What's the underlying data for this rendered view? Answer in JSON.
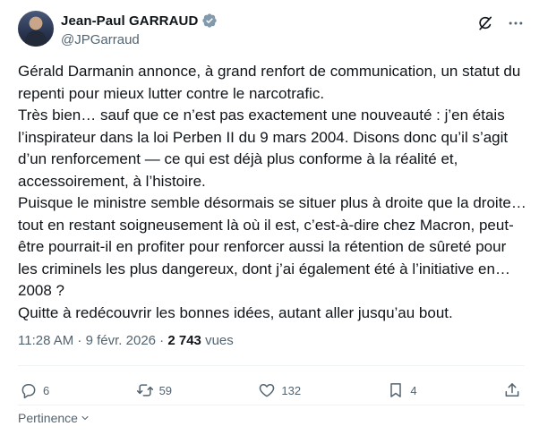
{
  "author": {
    "display_name": "Jean-Paul GARRAUD",
    "handle": "@JPGarraud",
    "verified": true
  },
  "tweet": {
    "paragraphs": [
      "Gérald Darmanin annonce, à grand renfort de communication, un statut du repenti pour mieux lutter contre le narcotrafic.",
      "Très bien… sauf que ce n’est pas exactement une nouveauté : j’en étais l’inspirateur dans la loi Perben II du 9 mars 2004. Disons donc qu’il s’agit d’un renforcement — ce qui est déjà plus conforme à la réalité et, accessoirement, à l’histoire.",
      "Puisque le ministre semble désormais se situer plus à droite que la droite… tout en restant soigneusement là où il est, c’est-à-dire chez Macron, peut-être pourrait-il en profiter pour renforcer aussi la rétention de sûreté pour les criminels les plus dangereux, dont j’ai également été à l’initiative en…2008 ?",
      "Quitte à redécouvrir les bonnes idées, autant aller jusqu’au bout."
    ],
    "time": "11:28 AM",
    "separator": " · ",
    "date": "9 févr. 2026",
    "views_count": "2 743",
    "views_label": " vues"
  },
  "actions": {
    "replies": "6",
    "reposts": "59",
    "likes": "132",
    "bookmarks": "4"
  },
  "footer": {
    "sort_label": "Pertinence"
  },
  "icons": {
    "verified": "verified-badge-icon",
    "grok": "grok-icon",
    "more": "more-icon",
    "reply": "reply-icon",
    "repost": "repost-icon",
    "like": "like-icon",
    "bookmark": "bookmark-icon",
    "share": "share-icon"
  },
  "colors": {
    "text": "#0f1419",
    "muted": "#536471",
    "verified": "#829aab",
    "divider": "#eff3f4"
  }
}
